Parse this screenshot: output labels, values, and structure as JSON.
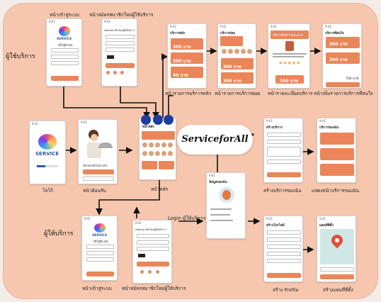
{
  "center_title": "ServiceforAll",
  "roles": {
    "user": "ผู้ใช้บริการ",
    "provider": "ผู้ให้บริการ"
  },
  "flow_label": "Login ผู้ให้บริการ",
  "top_screens": [
    {
      "title": "หน้าเข้าสู่ระบบ",
      "heading": "เข้าสู่ระบบ",
      "logo_text": "SERVICE"
    },
    {
      "title": "หน้าสมัครสมาชิกใหม่ผู้ใช้บริการ",
      "heading": "สมัครสมาชิกใหม่ผู้ใช้บริการ"
    }
  ],
  "user_screens": [
    {
      "caption": "หน้ารายการบริการหลัก",
      "heading": "บริการหลัก",
      "prices": [
        "300 บาท",
        "300 บาท",
        "40 บาท"
      ]
    },
    {
      "caption": "หน้ารายการบริการย่อย",
      "heading": "บริการย่อย",
      "prices": [
        "300 บาท",
        "300 บาท"
      ]
    },
    {
      "caption": "หน้ารายละเอียดบริการ",
      "heading": "บริการทำความสะอาด",
      "prices": [
        "300 บาท"
      ],
      "stars": "★★★★★"
    },
    {
      "caption": "หน้าเพิ่มรายการบริการที่สนใจ",
      "heading": "บริการที่สนใจ",
      "prices": [
        "300 บาท",
        "300 บาท"
      ],
      "total": "700 บาท"
    }
  ],
  "middle_screens": [
    {
      "caption": "โลโก้",
      "logo_text": "SERVICE"
    },
    {
      "caption": "หน้าต้อนรับ",
      "email": "Serviceforall.com"
    },
    {
      "caption": "หน้าหลัก",
      "heading": "หน้าหลัก"
    }
  ],
  "provider_screens": [
    {
      "caption": "หน้าเข้าสู่ระบบ",
      "heading": "เข้าสู่ระบบ",
      "logo_text": "SERVICE"
    },
    {
      "caption": "หน้าสมัครสมาชิกใหม่ผู้ให้บริการ",
      "heading": "สมัครสมาชิกใหม่ผู้ให้บริการ"
    },
    {
      "heading": "ข้อมูลของฉัน"
    }
  ],
  "right_screens": [
    {
      "caption": "สร้างบริการของฉัน",
      "heading": "สร้างบริการ"
    },
    {
      "caption": "แสดงหน้าบริการของฉัน",
      "heading": "บริการของฉัน"
    },
    {
      "caption": "สร้าง Profile",
      "heading": "สร้างโปรไฟล์"
    },
    {
      "caption": "สร้างแผนที่ที่ตั้ง",
      "heading": "แผนที่ที่ตั้ง"
    }
  ],
  "colors": {
    "board": "#f6c7ae",
    "accent": "#ea8659",
    "highlight": "#1d3c9e"
  }
}
